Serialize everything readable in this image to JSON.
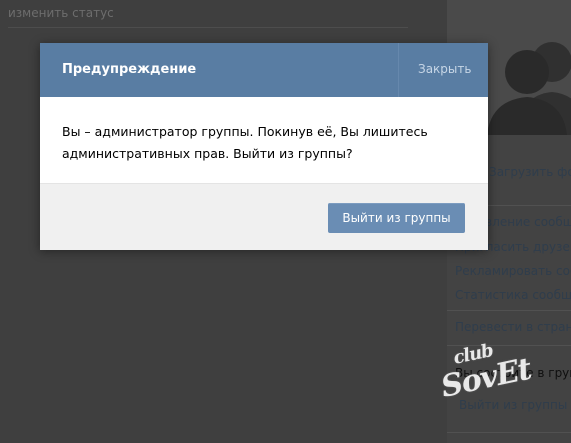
{
  "background": {
    "status_placeholder": "изменить статус",
    "upload_photo": "Загрузить фото",
    "side_links": [
      "Управление сообщ",
      "Пригласить друзей",
      "Рекламировать соо",
      "Статистика сообще",
      "Перевести в стран"
    ],
    "member_status": "Вы состоите в груп",
    "leave_group_link": "Выйти из группы",
    "watermark": "SovEt",
    "watermark_small": "club"
  },
  "modal": {
    "title": "Предупреждение",
    "close_label": "Закрыть",
    "message": "Вы – администратор группы. Покинув её, Вы лишитесь административных прав. Выйти из группы?",
    "confirm_label": "Выйти из группы"
  },
  "colors": {
    "header": "#597da3",
    "button": "#6a8db4",
    "overlay": "#3f3f3f"
  }
}
